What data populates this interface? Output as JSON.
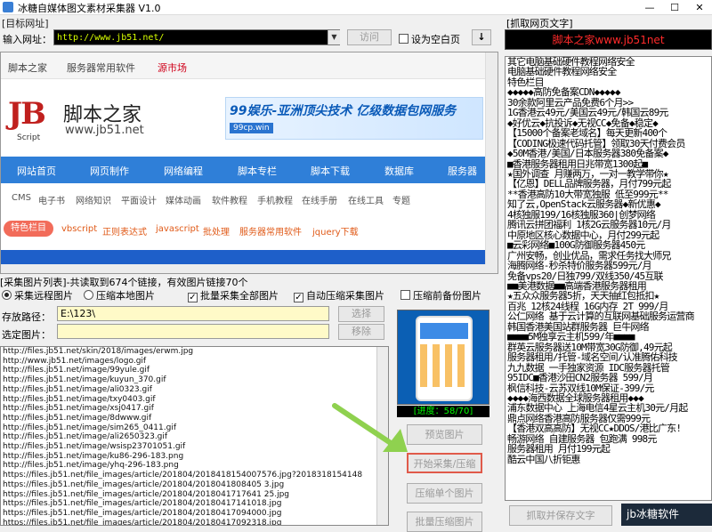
{
  "window": {
    "title": "冰糖自媒体图文素材采集器 V1.0",
    "min": "—",
    "max": "☐",
    "close": "✕"
  },
  "url_group": {
    "label": "[目标网址]",
    "input_label": "输入网址：",
    "url": "http://www.jb51.net/",
    "visit": "访问",
    "blank_label": "设为空白页",
    "down": "↓"
  },
  "browser": {
    "tabs": [
      "脚本之家",
      "服务器常用软件",
      "源市场"
    ],
    "site_name": "脚本之家",
    "site_url": "www.jb51.net",
    "logo_text": "JB",
    "logo_sub": "Script",
    "banner_title": "99娱乐-亚洲顶尖技术 亿级数据包网服务",
    "banner_sub": "99cp.win",
    "nav": [
      "网站首页",
      "网页制作",
      "网络编程",
      "脚本专栏",
      "脚本下载",
      "数据库",
      "服务器"
    ],
    "subnav": [
      "CMS",
      "电子书",
      "网络知识",
      "平面设计",
      "媒体动画",
      "软件教程",
      "手机教程",
      "在线手册",
      "在线工具",
      "专题"
    ],
    "tag": "特色栏目",
    "sub2": [
      "vbscript",
      "正则表达式",
      "javascript",
      "批处理",
      "服务器常用软件",
      "jquery下载"
    ]
  },
  "collect": {
    "list_header": "[采集图片列表]-共读取到674个链接，有效图片链接70个",
    "opt_remote": "采集远程图片",
    "opt_local": "压缩本地图片",
    "chk_batch": "批量采集全部图片",
    "chk_auto": "自动压缩采集图片",
    "chk_prefix": "压缩前备份图片",
    "save_label": "存放路径：",
    "save_value": "E:\\123\\",
    "select_label": "选定图片：",
    "select_value": "",
    "btn_select": "选择",
    "btn_remove": "移除",
    "progress": "[进度：58/70]",
    "btn_preview": "预览图片",
    "btn_start": "开始采集/压缩",
    "btn_single": "压缩单个图片",
    "btn_batch": "批量压缩图片"
  },
  "image_list": [
    "http://files.jb51.net/skin/2018/images/erwm.jpg",
    "http://www.jb51.net/images/logo.gif",
    "http://files.jb51.net/image/99yule.gif",
    "http://files.jb51.net/image/kuyun_370.gif",
    "http://files.jb51.net/image/ali0323.gif",
    "http://files.jb51.net/image/txy0403.gif",
    "http://files.jb51.net/image/xsj0417.gif",
    "http://files.jb51.net/image/8dwww.gif",
    "http://files.jb51.net/image/sim265_0411.gif",
    "http://files.jb51.net/image/ali2650323.gif",
    "http://files.jb51.net/image/wsisp23701051.gif",
    "http://files.jb51.net/image/ku86-296-183.png",
    "http://files.jb51.net/image/yhq-296-183.png",
    "https://files.jb51.net/file_images/article/201804/2018418154007576.jpg?2018318154148",
    "https://files.jb51.net/file_images/article/201804/2018041808405 3.jpg",
    "https://files.jb51.net/file_images/article/201804/2018041717641 25.jpg",
    "https://files.jb51.net/file_images/article/201804/20180417141018.jpg",
    "https://files.jb51.net/file_images/article/201804/20180417094000.jpg",
    "https://files.jb51.net/file_images/article/201804/20180417092318.jpg"
  ],
  "right": {
    "label": "[抓取网页文字]",
    "title": "脚本之家www.jb51net",
    "lines": [
      "其它电脑基础硬件教程网络安全",
      "电脑基础硬件教程网络安全",
      "特色栏目",
      "◆◆◆◆◆高防免备案CDN◆◆◆◆◆",
      "30余款阿里云产品免费6个月>>",
      "1G香港云49元/美国云49元/韩国云89元",
      "◆好优云◆抗投诉◆无视CC◆免备◆稳定◆",
      "【15000个备案老域名】每天更新400个",
      "【CODING极速代码托管】领取30天付费会员",
      "◆50M香港/美国/日本服务器380免备案◆",
      "■香港服务器租用日兆带宽1300起■",
      "★国外调查 月赚两万，一对一教学带你★",
      "【亿恩】DELL品牌服务器，月付799元起",
      "**香港高防10大带宽独服 低至999元**",
      "知了云,OpenStack云服务器◆新优惠◆",
      "4核独服199/16核独服360|创梦网络",
      "腾讯云拼团福利 1核2G云服务器10元/月",
      "中原地区核心数据中心，月付299元起",
      "■云彩网络■100G防御服务器450元",
      "广州安畅，创业优品，需求任务找大师兄",
      "海腾网络-秒杀特价服务器599元/月",
      "免备vps20/日独799/双线350/45互联",
      "■■美港数据■■高端香港服务器租用",
      "★五众众服务器5折，天天抽红包抵扣★",
      "百兆 12核24线程 16G内存 2T 999/月",
      "公仁网络 基于云计算的互联网基础服务运营商",
      "韩国香港美国站群服务器 巨牛网络",
      "■■■■5M独享云主机599/年■■■■",
      "群英云服务器送10M带宽30G防御,49元起",
      "服务器租用/托管-域名空间/认准腾佑科技",
      "九九数据 一手独家资源 IDC服务器托管",
      "95IDC■香港沙田CN2服务器 599/月",
      "枫信科技-云苏双线10M保证-399/元",
      "◆◆◆◆海西数据全球服务器租用◆◆◆",
      "浦东数据中心 上海电信4星云主机30元/月起",
      "鼎点网络香港高防服务器仅需999元",
      "【香港双高高防】无视CC★DDOS/港比广东!",
      "畅游网络 自建服务器 包跑满 998元",
      "服务器租用 月付199元起",
      "酷云中国八折钜惠"
    ],
    "btn_grab": "抓取并保存文字",
    "watermark": "jb冰糖软件"
  }
}
